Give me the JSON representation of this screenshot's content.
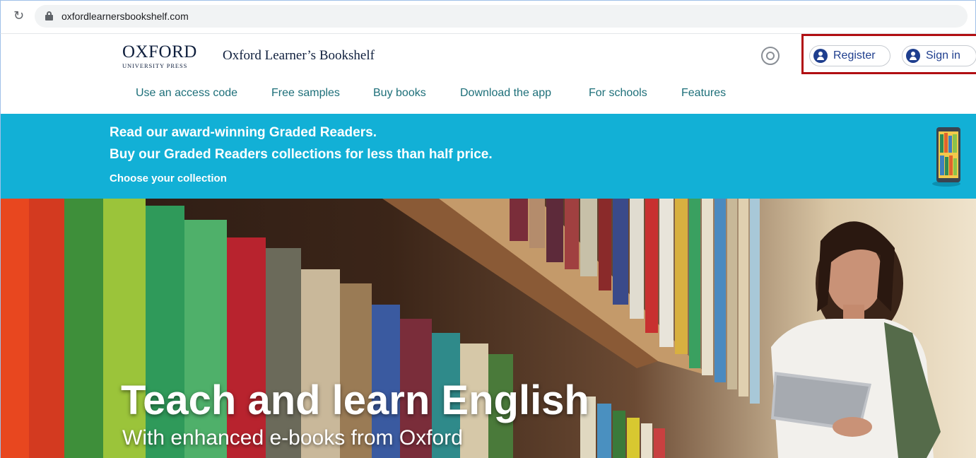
{
  "browser": {
    "url": "oxfordlearnersbookshelf.com"
  },
  "header": {
    "logo_main": "OXFORD",
    "logo_sub": "UNIVERSITY PRESS",
    "site_title": "Oxford Learner’s Bookshelf",
    "register_label": "Register",
    "signin_label": "Sign in"
  },
  "nav": {
    "items": [
      {
        "label": "Use an access code"
      },
      {
        "label": "Free samples"
      },
      {
        "label": "Buy books"
      },
      {
        "label": "Download the app"
      },
      {
        "label": "For schools"
      },
      {
        "label": "Features"
      }
    ]
  },
  "promo": {
    "line1": "Read our award-winning Graded Readers.",
    "line2": "Buy our Graded Readers collections for less than half price.",
    "link": "Choose your collection"
  },
  "hero": {
    "title": "Teach and learn English",
    "subtitle": "With enhanced e-books from Oxford"
  },
  "colors": {
    "brand_navy": "#1e3e8e",
    "nav_teal": "#1d6f79",
    "promo_blue": "#12b0d6",
    "highlight_red": "#b10e12"
  }
}
